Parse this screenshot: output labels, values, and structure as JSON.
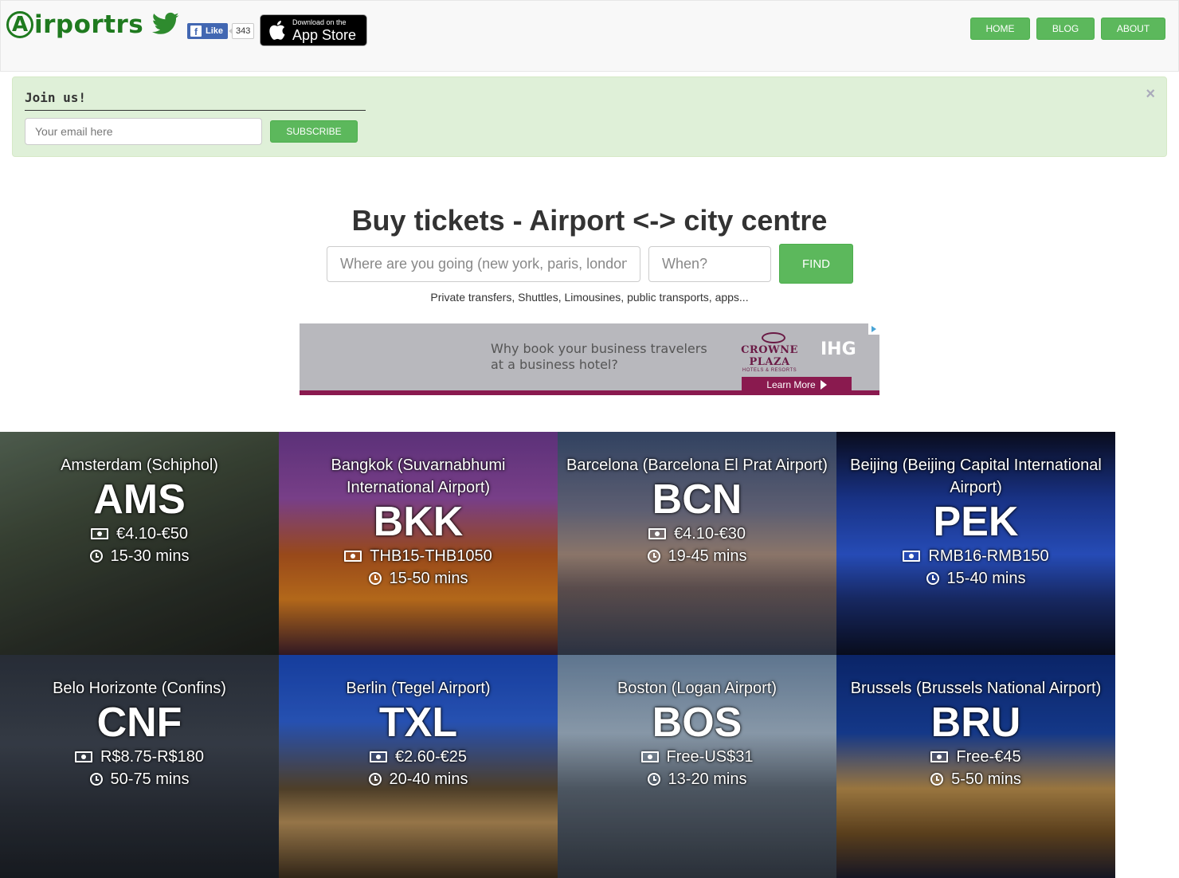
{
  "header": {
    "logo_letter": "A",
    "logo_text": "irportrs",
    "fb_like_label": "Like",
    "fb_like_count": "343",
    "appstore_small": "Download on the",
    "appstore_big": "App Store",
    "nav": [
      {
        "label": "HOME"
      },
      {
        "label": "BLOG"
      },
      {
        "label": "ABOUT"
      }
    ]
  },
  "join": {
    "title": "Join us!",
    "email_placeholder": "Your email here",
    "email_value": "",
    "subscribe_label": "SUBSCRIBE",
    "close_label": "×"
  },
  "search": {
    "title": "Buy tickets - Airport <-> city centre",
    "where_placeholder": "Where are you going (new york, paris, london...)",
    "when_placeholder": "When?",
    "find_label": "FIND",
    "subtitle": "Private transfers, Shuttles, Limousines, public transports, apps..."
  },
  "ad": {
    "line1": "Why book your business travelers",
    "line2": "at a business hotel?",
    "brand": "CROWNE PLAZA",
    "brand_sub": "HOTELS & RESORTS",
    "ihg": "IHG",
    "learn_more": "Learn More"
  },
  "airports": [
    {
      "name": "Amsterdam (Schiphol)",
      "code": "AMS",
      "price": "€4.10-€50",
      "time": "15-30 mins"
    },
    {
      "name": "Bangkok (Suvarnabhumi International Airport)",
      "code": "BKK",
      "price": "THB15-THB1050",
      "time": "15-50 mins"
    },
    {
      "name": "Barcelona (Barcelona El Prat Airport)",
      "code": "BCN",
      "price": "€4.10-€30",
      "time": "19-45 mins"
    },
    {
      "name": "Beijing (Beijing Capital International Airport)",
      "code": "PEK",
      "price": "RMB16-RMB150",
      "time": "15-40 mins"
    },
    {
      "name": "Belo Horizonte (Confins)",
      "code": "CNF",
      "price": "R$8.75-R$180",
      "time": "50-75 mins"
    },
    {
      "name": "Berlin (Tegel Airport)",
      "code": "TXL",
      "price": "€2.60-€25",
      "time": "20-40 mins"
    },
    {
      "name": "Boston (Logan Airport)",
      "code": "BOS",
      "price": "Free-US$31",
      "time": "13-20 mins"
    },
    {
      "name": "Brussels (Brussels National Airport)",
      "code": "BRU",
      "price": "Free-€45",
      "time": "5-50 mins"
    }
  ],
  "colors": {
    "brand_green": "#1f7a1f",
    "button_green": "#5cb85c",
    "banner_bg": "#dff0d8"
  }
}
